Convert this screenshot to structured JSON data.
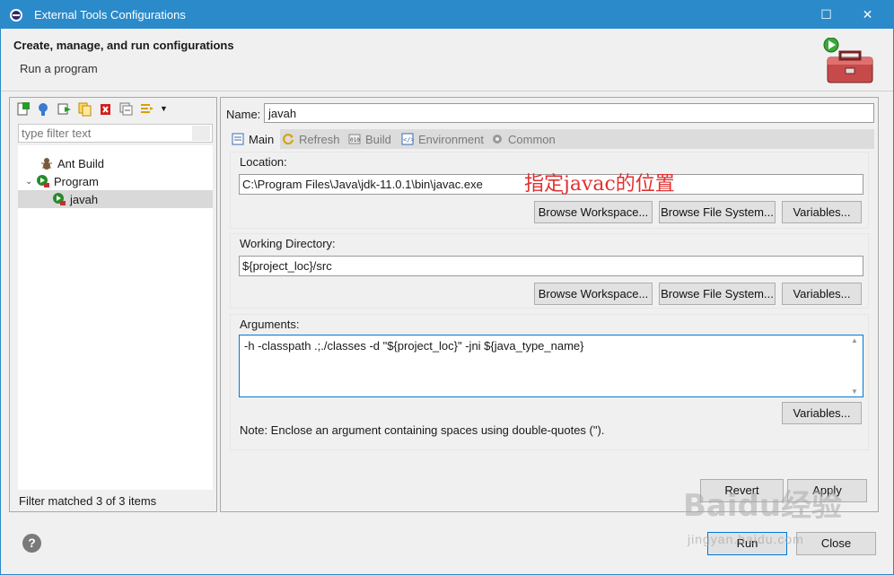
{
  "window": {
    "title": "External Tools Configurations"
  },
  "header": {
    "title": "Create, manage, and run configurations",
    "subtitle": "Run a program"
  },
  "left": {
    "filter_placeholder": "type filter text",
    "tree": [
      {
        "label": "Ant Build"
      },
      {
        "label": "Program"
      },
      {
        "label": "javah"
      }
    ],
    "status": "Filter matched 3 of 3 items"
  },
  "right": {
    "name_label": "Name:",
    "name_value": "javah",
    "tabs": [
      {
        "label": "Main"
      },
      {
        "label": "Refresh"
      },
      {
        "label": "Build"
      },
      {
        "label": "Environment"
      },
      {
        "label": "Common"
      }
    ],
    "location": {
      "label": "Location:",
      "value": "C:\\Program Files\\Java\\jdk-11.0.1\\bin\\javac.exe",
      "btn_workspace": "Browse Workspace...",
      "btn_filesystem": "Browse File System...",
      "btn_variables": "Variables..."
    },
    "workdir": {
      "label": "Working Directory:",
      "value": "${project_loc}/src",
      "btn_workspace": "Browse Workspace...",
      "btn_filesystem": "Browse File System...",
      "btn_variables": "Variables..."
    },
    "arguments": {
      "label": "Arguments:",
      "value": "-h -classpath .;./classes -d \"${project_loc}\" -jni ${java_type_name}",
      "btn_variables": "Variables...",
      "note": "Note: Enclose an argument containing spaces using double-quotes (\")."
    },
    "annotation": "指定javac的位置",
    "btn_revert": "Revert",
    "btn_apply": "Apply"
  },
  "footer": {
    "btn_run": "Run",
    "btn_close": "Close"
  },
  "watermark": {
    "main": "Baidu经验",
    "sub": "jingyan.baidu.com"
  }
}
